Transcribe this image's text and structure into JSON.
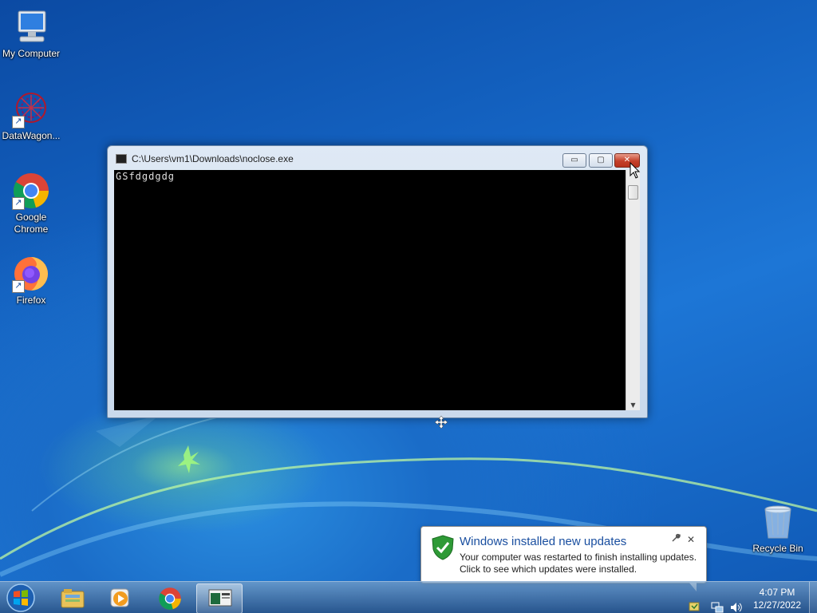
{
  "desktop": {
    "icons": [
      {
        "label": "My Computer",
        "icon": "computer-icon"
      },
      {
        "label": "DataWagon...",
        "icon": "datawagon-icon"
      },
      {
        "label": "Google Chrome",
        "icon": "chrome-icon"
      },
      {
        "label": "Firefox",
        "icon": "firefox-icon"
      },
      {
        "label": "Recycle Bin",
        "icon": "recycle-bin-icon"
      }
    ]
  },
  "window": {
    "title": "C:\\Users\\vm1\\Downloads\\noclose.exe",
    "console_output": "GSfdgdgdg",
    "buttons": {
      "minimize": "▭",
      "maximize": "▢",
      "close": "✕"
    }
  },
  "notification": {
    "title": "Windows installed new updates",
    "line1": "Your computer was restarted to finish installing updates.",
    "line2": "Click to see which updates were installed.",
    "close": "✕"
  },
  "taskbar": {
    "pinned": [
      "windows-explorer-icon",
      "media-player-icon",
      "chrome-icon",
      "console-icon"
    ],
    "tray_icons": [
      "action-center-icon",
      "network-icon",
      "volume-icon"
    ],
    "time": "4:07 PM",
    "date": "12/27/2022"
  },
  "colors": {
    "accent": "#1a4fa0",
    "close_button": "#c4402a"
  }
}
